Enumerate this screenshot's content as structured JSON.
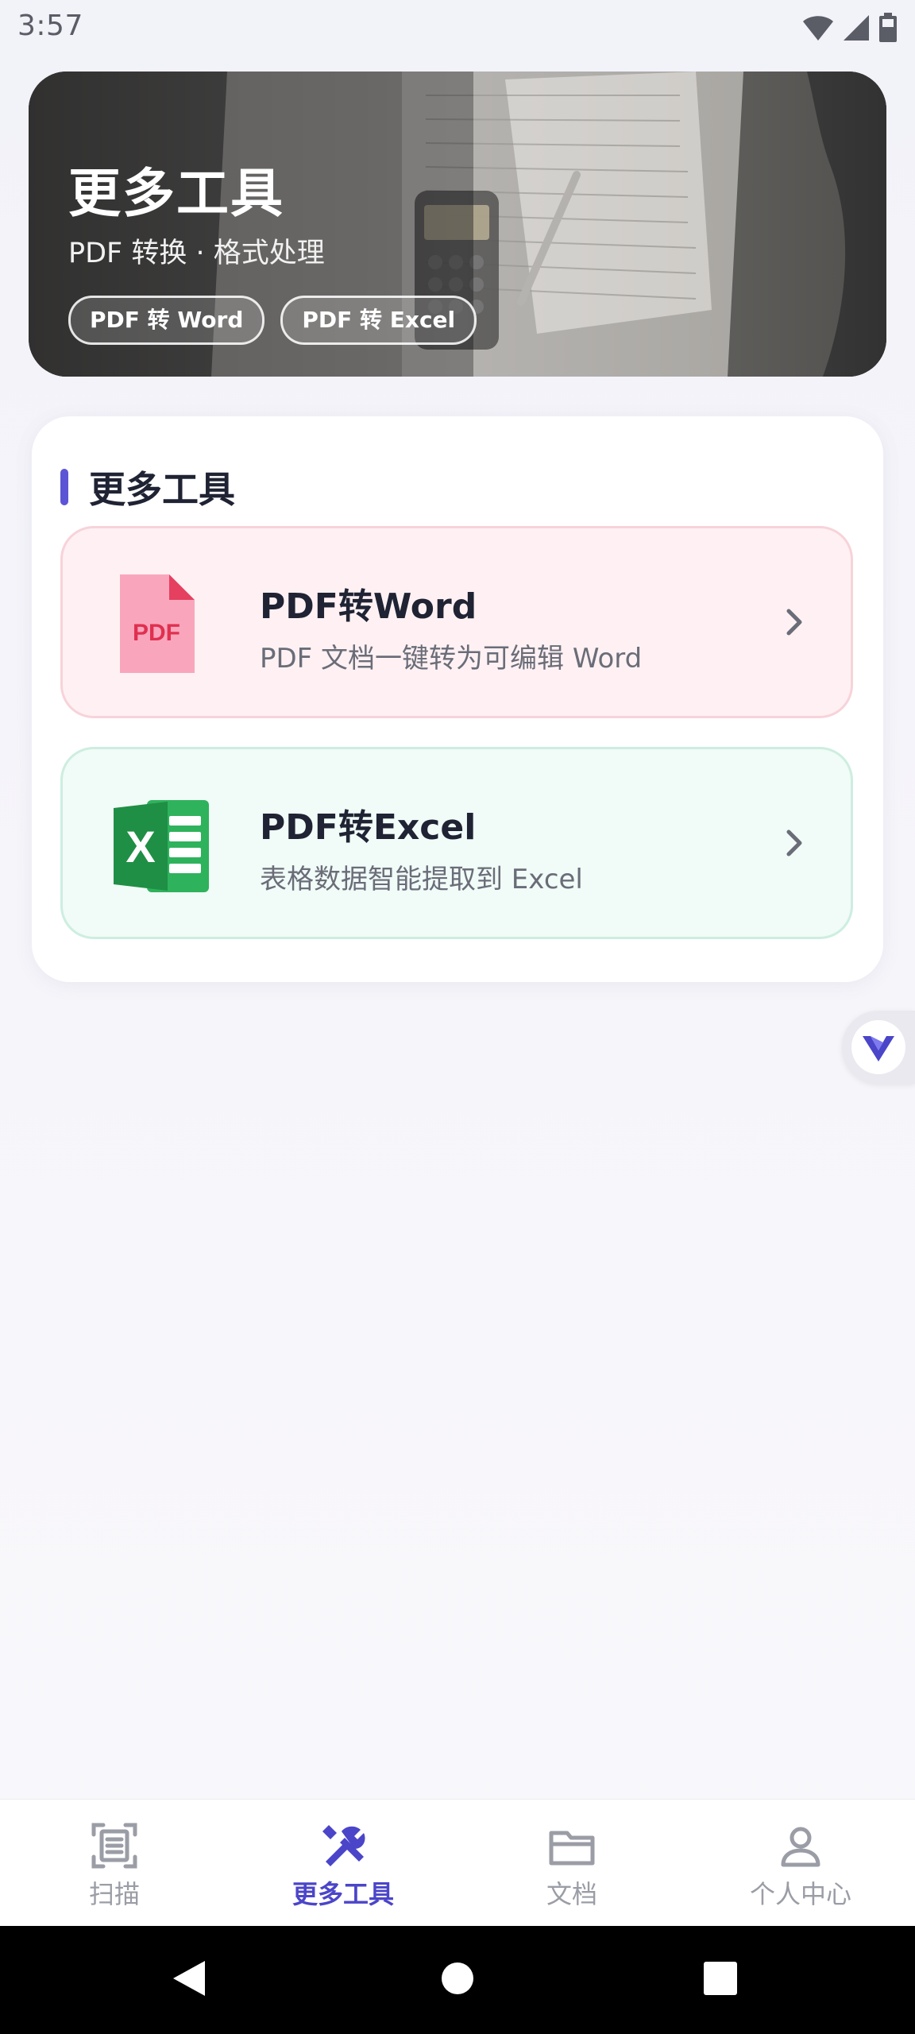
{
  "status_bar": {
    "time": "3:57",
    "icons": [
      "wifi-icon",
      "signal-icon",
      "battery-icon"
    ]
  },
  "hero": {
    "title": "更多工具",
    "subtitle": "PDF 转换 · 格式处理",
    "chips": [
      "PDF 转 Word",
      "PDF 转 Excel"
    ]
  },
  "tools_section": {
    "title": "更多工具",
    "accent_color": "#5b55d6",
    "items": [
      {
        "name": "PDF转Word",
        "description": "PDF 文档一键转为可编辑 Word",
        "icon": "pdf-file-icon",
        "icon_text": "PDF",
        "background": "#fff1f3"
      },
      {
        "name": "PDF转Excel",
        "description": "表格数据智能提取到 Excel",
        "icon": "excel-icon",
        "icon_text": "X",
        "background": "#f1fbf7"
      }
    ]
  },
  "floating_button": {
    "icon": "v-logo-icon"
  },
  "bottom_nav": {
    "active_color": "#4b45c9",
    "items": [
      {
        "label": "扫描",
        "icon": "scan-icon",
        "active": false
      },
      {
        "label": "更多工具",
        "icon": "tools-icon",
        "active": true
      },
      {
        "label": "文档",
        "icon": "folder-icon",
        "active": false
      },
      {
        "label": "个人中心",
        "icon": "person-icon",
        "active": false
      }
    ]
  },
  "system_nav": {
    "icons": [
      "back-icon",
      "home-icon",
      "recents-icon"
    ]
  }
}
